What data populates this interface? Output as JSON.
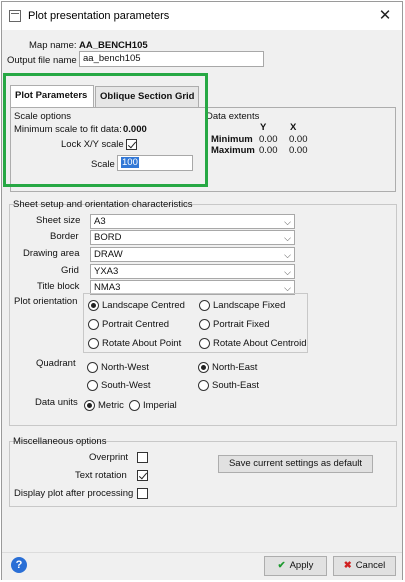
{
  "window": {
    "title": "Plot presentation parameters",
    "close_glyph": "✕"
  },
  "header": {
    "map_name_label": "Map name:",
    "map_name_value": "AA_BENCH105",
    "output_label": "Output file name",
    "output_value": "aa_bench105"
  },
  "tabs": [
    {
      "label": "Plot Parameters",
      "active": true
    },
    {
      "label": "Oblique Section Grid",
      "active": false
    }
  ],
  "scale_options": {
    "title": "Scale options",
    "min_scale_label": "Minimum scale to fit data:",
    "min_scale_value": "0.000",
    "lock_label": "Lock X/Y scale",
    "lock_checked": true,
    "scale_label": "Scale",
    "scale_value": "100"
  },
  "data_extents": {
    "title": "Data extents",
    "col_y": "Y",
    "col_x": "X",
    "rows": [
      {
        "label": "Minimum",
        "y": "0.00",
        "x": "0.00"
      },
      {
        "label": "Maximum",
        "y": "0.00",
        "x": "0.00"
      }
    ]
  },
  "sheet_setup": {
    "title": "Sheet setup and orientation characteristics",
    "fields": [
      {
        "label": "Sheet size",
        "value": "A3"
      },
      {
        "label": "Border",
        "value": "BORD"
      },
      {
        "label": "Drawing area",
        "value": "DRAW"
      },
      {
        "label": "Grid",
        "value": "YXA3"
      },
      {
        "label": "Title block",
        "value": "NMA3"
      }
    ],
    "orientation_label": "Plot orientation",
    "orientation_options": [
      {
        "label": "Landscape Centred",
        "selected": true
      },
      {
        "label": "Landscape Fixed",
        "selected": false
      },
      {
        "label": "Portrait Centred",
        "selected": false
      },
      {
        "label": "Portrait Fixed",
        "selected": false
      },
      {
        "label": "Rotate About Point",
        "selected": false
      },
      {
        "label": "Rotate About Centroid",
        "selected": false
      }
    ],
    "quadrant_label": "Quadrant",
    "quadrant_options": [
      {
        "label": "North-West",
        "selected": false
      },
      {
        "label": "North-East",
        "selected": true
      },
      {
        "label": "South-West",
        "selected": false
      },
      {
        "label": "South-East",
        "selected": false
      }
    ],
    "units_label": "Data units",
    "units_options": [
      {
        "label": "Metric",
        "selected": true
      },
      {
        "label": "Imperial",
        "selected": false
      }
    ]
  },
  "misc": {
    "title": "Miscellaneous options",
    "overprint_label": "Overprint",
    "overprint_checked": false,
    "text_rotation_label": "Text rotation",
    "text_rotation_checked": true,
    "display_plot_label": "Display plot after processing",
    "display_plot_checked": false,
    "save_default_label": "Save current settings as default"
  },
  "footer": {
    "help_glyph": "?",
    "apply_label": "Apply",
    "cancel_label": "Cancel"
  },
  "colors": {
    "highlight_box": "#27a844",
    "help": "#2a6fd6",
    "apply_check": "#1d9a2f",
    "cancel_x": "#d02020"
  }
}
